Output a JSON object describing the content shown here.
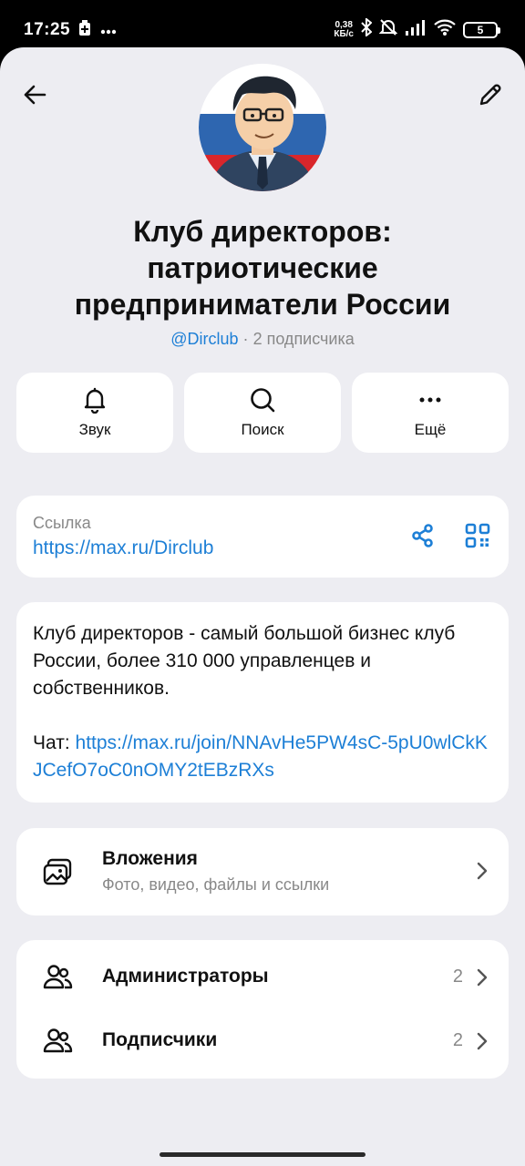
{
  "status_bar": {
    "time": "17:25",
    "net_speed_value": "0,38",
    "net_speed_unit": "КБ/с",
    "battery": "5"
  },
  "header": {
    "title": "Клуб директоров: патриотические предприниматели России",
    "handle": "@Dirclub",
    "separator": "·",
    "subscribers": "2 подписчика"
  },
  "actions": [
    {
      "label": "Звук",
      "icon": "bell-icon"
    },
    {
      "label": "Поиск",
      "icon": "search-icon"
    },
    {
      "label": "Ещё",
      "icon": "more-icon"
    }
  ],
  "link": {
    "caption": "Ссылка",
    "url": "https://max.ru/Dirclub"
  },
  "description": {
    "text": "Клуб директоров - самый большой бизнес клуб России, более 310 000 управленцев и собственников.",
    "chat_label": "Чат: ",
    "chat_url": "https://max.ru/join/NNAvHe5PW4sC-5pU0wlCkKJCefO7oC0nOMY2tEBzRXs"
  },
  "attachments": {
    "title": "Вложения",
    "subtitle": "Фото, видео, файлы и ссылки"
  },
  "people": [
    {
      "label": "Администраторы",
      "count": "2"
    },
    {
      "label": "Подписчики",
      "count": "2"
    }
  ],
  "colors": {
    "accent": "#1d7fd6",
    "background": "#ededf2",
    "card": "#ffffff"
  }
}
